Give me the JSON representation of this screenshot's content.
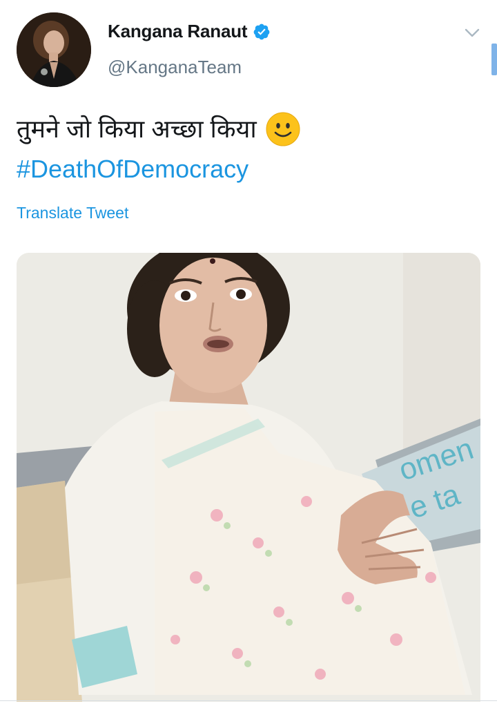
{
  "author": {
    "display_name": "Kangana Ranaut",
    "handle": "@KanganaTeam",
    "verified": true,
    "avatar_icon": "profile-photo"
  },
  "tweet": {
    "text_hindi": "तुमने जो किया अच्छा किया",
    "emoji_icon": "slightly-smiling-face-icon",
    "hashtag": "#DeathOfDemocracy",
    "translate_label": "Translate Tweet"
  },
  "media": {
    "type": "video-thumbnail",
    "pillow_text_1": "omen",
    "pillow_text_2": "e ta"
  },
  "colors": {
    "link": "#1b95e0",
    "name": "#14171a",
    "handle": "#657786",
    "verified": "#1da1f2"
  }
}
